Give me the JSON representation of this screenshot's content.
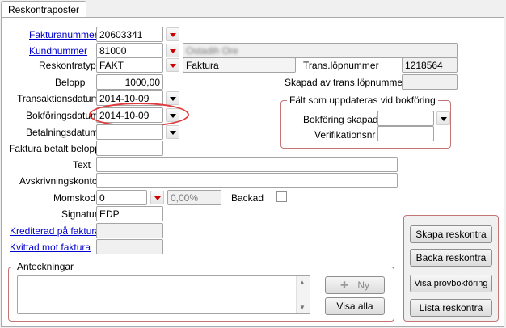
{
  "tab": {
    "label": "Reskontraposter"
  },
  "form": {
    "fakturanummer_label": "Fakturanummer",
    "fakturanummer_value": "20603341",
    "kundnummer_label": "Kundnummer",
    "kundnummer_value": "81000",
    "kundnamn_value": "Ostadih Ore",
    "reskontratyp_label": "Reskontratyp",
    "reskontratyp_value": "FAKT",
    "reskontratyp_desc": "Faktura",
    "belopp_label": "Belopp",
    "belopp_value": "1000,00",
    "transaktionsdatum_label": "Transaktionsdatum",
    "transaktionsdatum_value": "2014-10-09",
    "bokforingsdatum_label": "Bokföringsdatum",
    "bokforingsdatum_value": "2014-10-09",
    "betalningsdatum_label": "Betalningsdatum",
    "betalningsdatum_value": "",
    "faktura_betalt_label": "Faktura betalt belopp",
    "faktura_betalt_value": "",
    "text_label": "Text",
    "text_value": "",
    "avskrivningskonto_label": "Avskrivningskonto",
    "avskrivningskonto_value": "",
    "momskod_label": "Momskod",
    "momskod_value": "0",
    "momskod_percent": "0,00%",
    "backad_label": "Backad",
    "signatur_label": "Signatur",
    "signatur_value": "EDP",
    "krediterad_label": "Krediterad på faktura",
    "krediterad_value": "",
    "kvittad_label": "Kvittad mot faktura",
    "kvittad_value": "",
    "trans_lopnummer_label": "Trans.löpnummer",
    "trans_lopnummer_value": "1218564",
    "skapad_av_label": "Skapad av trans.löpnummer",
    "skapad_av_value": ""
  },
  "bokforing_group": {
    "title": "Fält som uppdateras vid bokföring",
    "bokforing_skapad_label": "Bokföring skapad",
    "bokforing_skapad_value": "",
    "verifikationsnr_label": "Verifikationsnr",
    "verifikationsnr_value": ""
  },
  "anteckningar": {
    "title": "Anteckningar",
    "ny_label": "Ny",
    "visa_alla_label": "Visa alla"
  },
  "actions": {
    "skapa": "Skapa reskontra",
    "backa": "Backa reskontra",
    "visa_prov": "Visa provbokföring",
    "lista": "Lista reskontra"
  },
  "colors": {
    "dropdown_red": "#cc0000",
    "group_border": "#c37474",
    "highlight": "#e03a3a",
    "link": "#0000cc"
  }
}
